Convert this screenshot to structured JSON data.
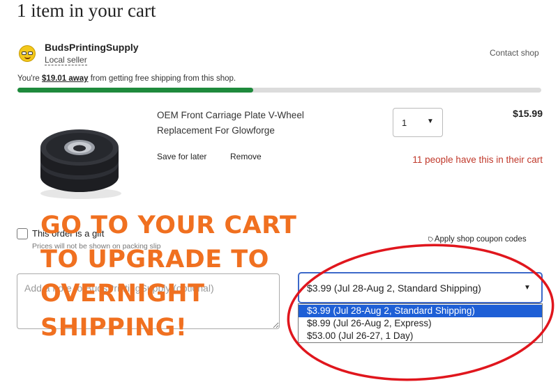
{
  "cart": {
    "title": "1 item in your cart"
  },
  "shop": {
    "name": "BudsPrintingSupply",
    "badge": "Local seller",
    "contact_label": "Contact shop"
  },
  "free_shipping": {
    "prefix": "You're ",
    "amount": "$19.01 away",
    "suffix": " from getting free shipping from this shop.",
    "progress_fraction": 0.45,
    "bar_color": "#1e8a3c"
  },
  "item": {
    "title": "OEM Front Carriage Plate V-Wheel Replacement For Glowforge",
    "save_for_later": "Save for later",
    "remove": "Remove",
    "quantity": "1",
    "price": "$15.99",
    "popularity_note": "11 people have this in their cart"
  },
  "gift": {
    "label": "This order is a gift",
    "note": "Prices will not be shown on packing slip"
  },
  "coupon": {
    "label": "Apply shop coupon codes",
    "icon": "tag-icon"
  },
  "note_to_seller": {
    "placeholder": "Add a note to BudsPrintingSupply (optional)",
    "value": ""
  },
  "shipping": {
    "selected": "$3.99 (Jul 28-Aug 2, Standard Shipping)",
    "options": [
      "$3.99 (Jul 28-Aug 2, Standard Shipping)",
      "$8.99 (Jul 26-Aug 2, Express)",
      "$53.00 (Jul 26-27, 1 Day)"
    ]
  },
  "overlay": {
    "lines": [
      "GO TO YOUR CART",
      "TO UPGRADE TO",
      "OVERNIGHT",
      "SHIPPING!"
    ],
    "text_color": "#f07020",
    "ellipse_color": "#e0161d"
  }
}
